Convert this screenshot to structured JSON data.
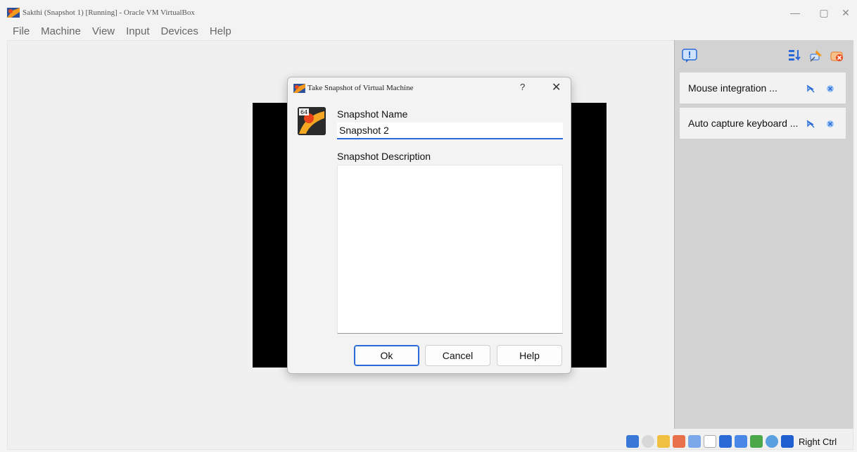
{
  "window": {
    "title": "Sakthi (Snapshot 1) [Running] - Oracle VM VirtualBox",
    "controls": {
      "minimize": "—",
      "maximize": "▢",
      "close": "✕"
    }
  },
  "menu": [
    "File",
    "Machine",
    "View",
    "Input",
    "Devices",
    "Help"
  ],
  "dialog": {
    "title": "Take Snapshot of Virtual Machine",
    "help_glyph": "?",
    "close_glyph": "✕",
    "name_label": "Snapshot Name",
    "name_value": "Snapshot 2",
    "description_label": "Snapshot Description",
    "description_value": "",
    "buttons": {
      "ok": "Ok",
      "cancel": "Cancel",
      "help": "Help"
    },
    "icon_badge": "64"
  },
  "notifications": [
    {
      "text": "Mouse integration ..."
    },
    {
      "text": "Auto capture keyboard ..."
    }
  ],
  "status": {
    "host_key": "Right Ctrl"
  },
  "colors": {
    "accent": "#2a6ad6",
    "vm_screen": "#000000",
    "panel": "#d2d2d2"
  }
}
